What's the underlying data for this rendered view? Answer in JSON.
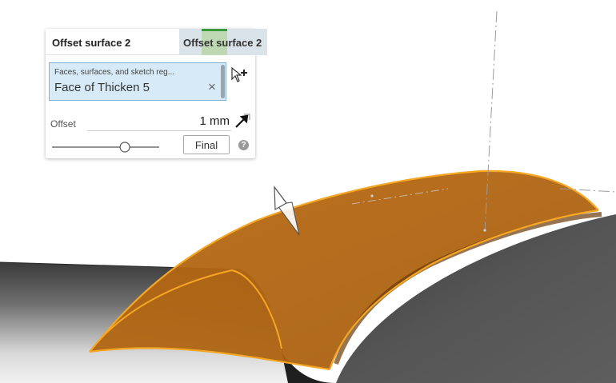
{
  "dialog": {
    "title": "Offset surface 2",
    "tab_label": "Offset surface 2",
    "selection": {
      "placeholder": "Faces, surfaces, and sketch reg...",
      "item": "Face of Thicken 5",
      "remove_glyph": "×"
    },
    "offset": {
      "label": "Offset",
      "value": "1 mm"
    },
    "slider_value": 0.68,
    "final_label": "Final",
    "help_glyph": "?",
    "icons": {
      "add_selection": "cursor-plus-icon",
      "direction": "flip-direction-arrow-icon",
      "help": "help-icon",
      "remove": "close-icon"
    }
  },
  "colors": {
    "highlight_orange": "#F5A623",
    "selected_face": "#B76A12",
    "selection_box_bg": "#D6EAF7",
    "tab_accent_green": "#3B9A3B"
  }
}
